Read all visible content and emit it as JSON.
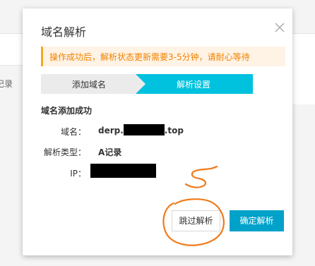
{
  "background": {
    "left_fragment": "记录"
  },
  "dialog": {
    "title": "域名解析",
    "close_icon": "close-icon",
    "notice": "操作成功后，解析状态更新需要3-5分钟，请耐心等待",
    "steps": [
      {
        "label": "添加域名",
        "active": false
      },
      {
        "label": "解析设置",
        "active": true
      }
    ],
    "section_title": "域名添加成功",
    "fields": {
      "domain_label": "域名：",
      "domain_prefix": "derp.",
      "domain_suffix": ".top",
      "type_label": "解析类型：",
      "type_value": "A记录",
      "ip_label": "IP："
    },
    "buttons": {
      "skip": "跳过解析",
      "confirm": "确定解析"
    }
  },
  "colors": {
    "accent": "#00a2ca",
    "notice_bg": "#fff3e5",
    "notice_text": "#f08200",
    "annotation": "#f07a1a"
  }
}
